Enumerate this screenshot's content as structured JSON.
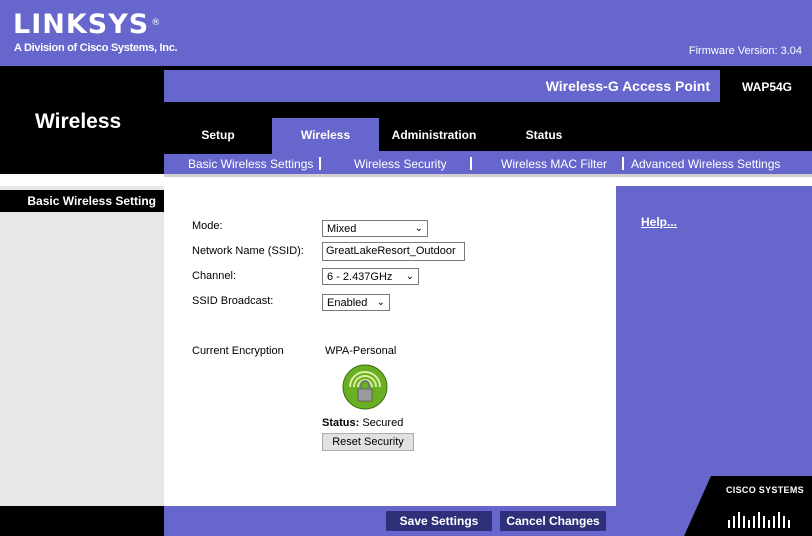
{
  "brand": {
    "logo": "LINKSYS",
    "reg": "®",
    "tagline": "A Division of Cisco Systems, Inc.",
    "firmware": "Firmware Version: 3.04"
  },
  "product": {
    "name": "Wireless-G Access Point",
    "model": "WAP54G"
  },
  "section_title": "Wireless",
  "tabs": [
    {
      "label": "Setup"
    },
    {
      "label": "Wireless"
    },
    {
      "label": "Administration"
    },
    {
      "label": "Status"
    }
  ],
  "subtabs": [
    {
      "label": "Basic Wireless Settings"
    },
    {
      "label": "Wireless Security"
    },
    {
      "label": "Wireless MAC Filter"
    },
    {
      "label": "Advanced Wireless Settings"
    }
  ],
  "sidebar": {
    "label": "Basic Wireless Setting"
  },
  "help": "Help...",
  "form": {
    "mode": {
      "label": "Mode:",
      "value": "Mixed"
    },
    "ssid": {
      "label": "Network Name (SSID):",
      "value": "GreatLakeResort_Outdoor"
    },
    "channel": {
      "label": "Channel:",
      "value": "6 - 2.437GHz"
    },
    "broadcast": {
      "label": "SSID Broadcast:",
      "value": "Enabled"
    },
    "encryption": {
      "label": "Current Encryption",
      "value": "WPA-Personal"
    },
    "status": {
      "label": "Status:",
      "value": "Secured"
    },
    "reset_label": "Reset Security"
  },
  "footer": {
    "save": "Save Settings",
    "cancel": "Cancel Changes"
  },
  "cisco": "CISCO SYSTEMS",
  "colors": {
    "accent": "#6666cc",
    "button": "#2f2f7a",
    "lock_green": "#66aa22"
  }
}
